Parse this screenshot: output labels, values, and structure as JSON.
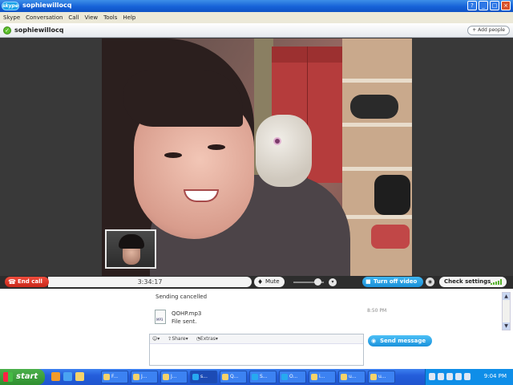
{
  "window": {
    "app_logo": "skype",
    "title": "sophiewillocq",
    "controls": [
      "?",
      "_",
      "□",
      "×"
    ]
  },
  "menu": [
    "Skype",
    "Conversation",
    "Call",
    "View",
    "Tools",
    "Help"
  ],
  "contact": {
    "name": "sophiewillocq",
    "add_people": "+ Add people",
    "status_color": "#5cbf2a"
  },
  "call": {
    "end_call": "End call",
    "duration": "3:34:17",
    "mute": "Mute",
    "turn_off_video": "Turn off video",
    "check_settings": "Check settings",
    "end_call_color": "#d9342a",
    "accent": "#1a91dc"
  },
  "chat": {
    "messages": [
      {
        "text": "Sending cancelled"
      },
      {
        "file": "QOHP.mp3",
        "status": "File sent.",
        "time": "8:50 PM"
      }
    ]
  },
  "compose": {
    "emoticon": "☺▾",
    "share": "Share",
    "extras": "Extras",
    "send": "Send message"
  },
  "taskbar": {
    "start": "start",
    "tasks": [
      "F...",
      "J...",
      "J...",
      "s...",
      "Q...",
      "S...",
      "O...",
      "i...",
      "u...",
      "u..."
    ],
    "clock": "9:04 PM"
  }
}
